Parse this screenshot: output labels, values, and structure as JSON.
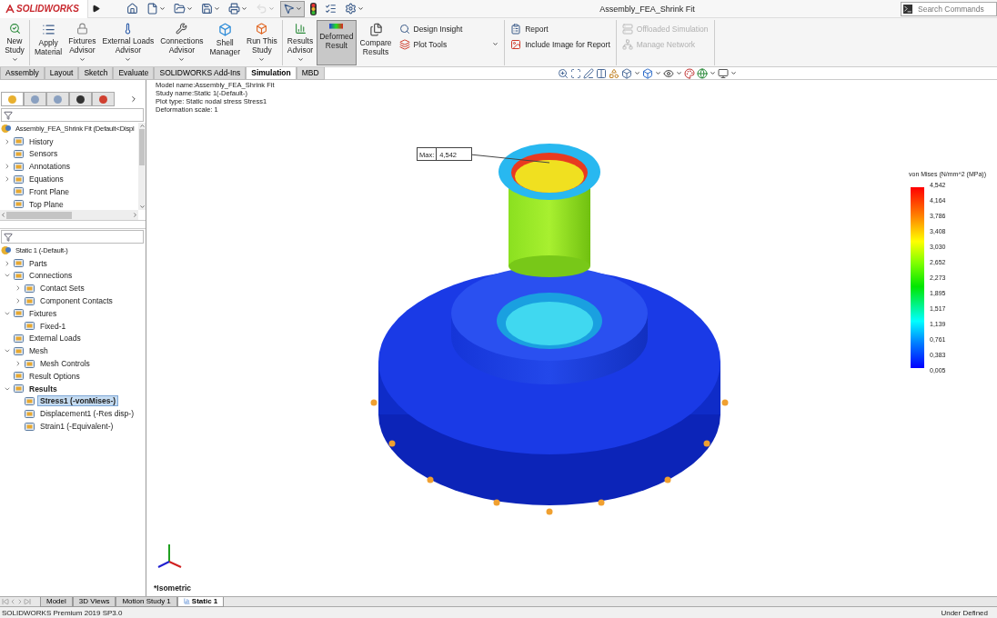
{
  "app": {
    "logo": "SOLIDWORKS",
    "title": "Assembly_FEA_Shrink Fit"
  },
  "quick_access": [
    {
      "kind": "home",
      "dropdown": false,
      "disabled": false,
      "pressed": false
    },
    {
      "kind": "new",
      "dropdown": true,
      "disabled": false,
      "pressed": false
    },
    {
      "kind": "open",
      "dropdown": true,
      "disabled": false,
      "pressed": false
    },
    {
      "kind": "save",
      "dropdown": true,
      "disabled": false,
      "pressed": false
    },
    {
      "kind": "print",
      "dropdown": true,
      "disabled": false,
      "pressed": false
    },
    {
      "kind": "undo",
      "dropdown": true,
      "disabled": true,
      "pressed": false
    },
    {
      "kind": "select",
      "dropdown": true,
      "disabled": false,
      "pressed": true
    },
    {
      "kind": "stoplight",
      "dropdown": false,
      "disabled": false,
      "pressed": false
    },
    {
      "kind": "list",
      "dropdown": false,
      "disabled": false,
      "pressed": false
    },
    {
      "kind": "settings",
      "dropdown": true,
      "disabled": false,
      "pressed": false
    }
  ],
  "search": {
    "placeholder": "Search Commands"
  },
  "ribbon": [
    {
      "buttons": [
        {
          "kind": "large",
          "lines": [
            "New",
            "Study"
          ],
          "dropdown": true,
          "selected": false,
          "disabled": false
        }
      ]
    },
    {
      "buttons": [
        {
          "kind": "large",
          "lines": [
            "Apply",
            "Material"
          ],
          "dropdown": false,
          "selected": false,
          "disabled": false
        },
        {
          "kind": "large",
          "lines": [
            "Fixtures",
            "Advisor"
          ],
          "dropdown": true,
          "selected": false,
          "disabled": false
        },
        {
          "kind": "large",
          "lines": [
            "External Loads",
            "Advisor"
          ],
          "dropdown": true,
          "selected": false,
          "disabled": false
        },
        {
          "kind": "large",
          "lines": [
            "Connections",
            "Advisor"
          ],
          "dropdown": true,
          "selected": false,
          "disabled": false
        },
        {
          "kind": "large",
          "lines": [
            "Shell",
            "Manager"
          ],
          "dropdown": false,
          "selected": false,
          "disabled": false
        },
        {
          "kind": "large",
          "lines": [
            "Run This",
            "Study"
          ],
          "dropdown": true,
          "selected": false,
          "disabled": false
        }
      ]
    },
    {
      "buttons": [
        {
          "kind": "large",
          "lines": [
            "Results",
            "Advisor"
          ],
          "dropdown": true,
          "selected": false,
          "disabled": false
        },
        {
          "kind": "large",
          "lines": [
            "Deformed",
            "Result"
          ],
          "dropdown": false,
          "selected": true,
          "disabled": false
        },
        {
          "kind": "large",
          "lines": [
            "Compare",
            "Results"
          ],
          "dropdown": false,
          "selected": false,
          "disabled": false
        },
        {
          "kind": "small",
          "lines": [
            "Design Insight"
          ],
          "dropdown": false,
          "disabled": false
        },
        {
          "kind": "small",
          "lines": [
            "Plot Tools"
          ],
          "dropdown": true,
          "disabled": false
        }
      ]
    },
    {
      "buttons": [
        {
          "kind": "small",
          "lines": [
            "Report"
          ],
          "dropdown": false,
          "disabled": false
        },
        {
          "kind": "small",
          "lines": [
            "Include Image for Report"
          ],
          "dropdown": false,
          "disabled": false
        }
      ]
    },
    {
      "buttons": [
        {
          "kind": "small",
          "lines": [
            "Offloaded Simulation"
          ],
          "dropdown": false,
          "disabled": true
        },
        {
          "kind": "small",
          "lines": [
            "Manage Network"
          ],
          "dropdown": false,
          "disabled": true
        }
      ]
    }
  ],
  "tabs": [
    {
      "label": "Assembly",
      "selected": false
    },
    {
      "label": "Layout",
      "selected": false
    },
    {
      "label": "Sketch",
      "selected": false
    },
    {
      "label": "Evaluate",
      "selected": false
    },
    {
      "label": "SOLIDWORKS Add-Ins",
      "selected": false
    },
    {
      "label": "Simulation",
      "selected": true
    },
    {
      "label": "MBD",
      "selected": false
    }
  ],
  "panel_tabs": [
    {
      "selected": true
    },
    {
      "selected": false
    },
    {
      "selected": false
    },
    {
      "selected": false
    },
    {
      "selected": false
    }
  ],
  "feature_tree": {
    "label": "Assembly_FEA_Shrink Fit  (Default<Displ",
    "children": [
      {
        "label": "History",
        "expandable": true,
        "expanded": false,
        "selected": false,
        "bold": false
      },
      {
        "label": "Sensors",
        "expandable": false,
        "selected": false,
        "bold": false
      },
      {
        "label": "Annotations",
        "expandable": true,
        "expanded": false,
        "selected": false,
        "bold": false
      },
      {
        "label": "Equations",
        "expandable": true,
        "expanded": false,
        "selected": false,
        "bold": false
      },
      {
        "label": "Front Plane",
        "expandable": false,
        "selected": false,
        "bold": false
      },
      {
        "label": "Top Plane",
        "expandable": false,
        "selected": false,
        "bold": false
      }
    ]
  },
  "study_tree": {
    "label": "Static 1 (-Default-)",
    "children": [
      {
        "label": "Parts",
        "expandable": true,
        "expanded": false,
        "selected": false,
        "bold": false
      },
      {
        "label": "Connections",
        "expandable": true,
        "expanded": true,
        "selected": false,
        "bold": false,
        "children": [
          {
            "label": "Contact Sets",
            "expandable": true,
            "expanded": false,
            "selected": false,
            "bold": false
          },
          {
            "label": "Component Contacts",
            "expandable": true,
            "expanded": false,
            "selected": false,
            "bold": false
          }
        ]
      },
      {
        "label": "Fixtures",
        "expandable": true,
        "expanded": true,
        "selected": false,
        "bold": false,
        "children": [
          {
            "label": "Fixed-1",
            "expandable": false,
            "selected": false,
            "bold": false
          }
        ]
      },
      {
        "label": "External Loads",
        "expandable": false,
        "selected": false,
        "bold": false
      },
      {
        "label": "Mesh",
        "expandable": true,
        "expanded": true,
        "selected": false,
        "bold": false,
        "children": [
          {
            "label": "Mesh Controls",
            "expandable": true,
            "expanded": false,
            "selected": false,
            "bold": false
          }
        ]
      },
      {
        "label": "Result Options",
        "expandable": false,
        "selected": false,
        "bold": false
      },
      {
        "label": "Results",
        "expandable": true,
        "expanded": true,
        "selected": false,
        "bold": true,
        "children": [
          {
            "label": "Stress1 (-vonMises-)",
            "expandable": false,
            "selected": true,
            "bold": true
          },
          {
            "label": "Displacement1 (-Res disp-)",
            "expandable": false,
            "selected": false,
            "bold": false
          },
          {
            "label": "Strain1 (-Equivalent-)",
            "expandable": false,
            "selected": false,
            "bold": false
          }
        ]
      }
    ]
  },
  "plot_info": [
    "Model name:Assembly_FEA_Shrink Fit",
    "Study name:Static 1(-Default-)",
    "Plot type: Static nodal stress Stress1",
    "Deformation scale: 1"
  ],
  "probe": {
    "label": "Max:",
    "value": "4,542"
  },
  "legend": {
    "title": "von Mises (N/mm^2 (MPa))",
    "values": [
      "4,542",
      "4,164",
      "3,786",
      "3,408",
      "3,030",
      "2,652",
      "2,273",
      "1,895",
      "1,517",
      "1,139",
      "0,761",
      "0,383",
      "0,005"
    ]
  },
  "view_label": "*Isometric",
  "bottom_tabs": [
    {
      "label": "Model",
      "selected": false
    },
    {
      "label": "3D Views",
      "selected": false
    },
    {
      "label": "Motion Study 1",
      "selected": false
    },
    {
      "label": "Static 1",
      "selected": true
    }
  ],
  "status_bar": {
    "left": "SOLIDWORKS Premium 2019 SP3.0",
    "right": "Under Defined"
  }
}
